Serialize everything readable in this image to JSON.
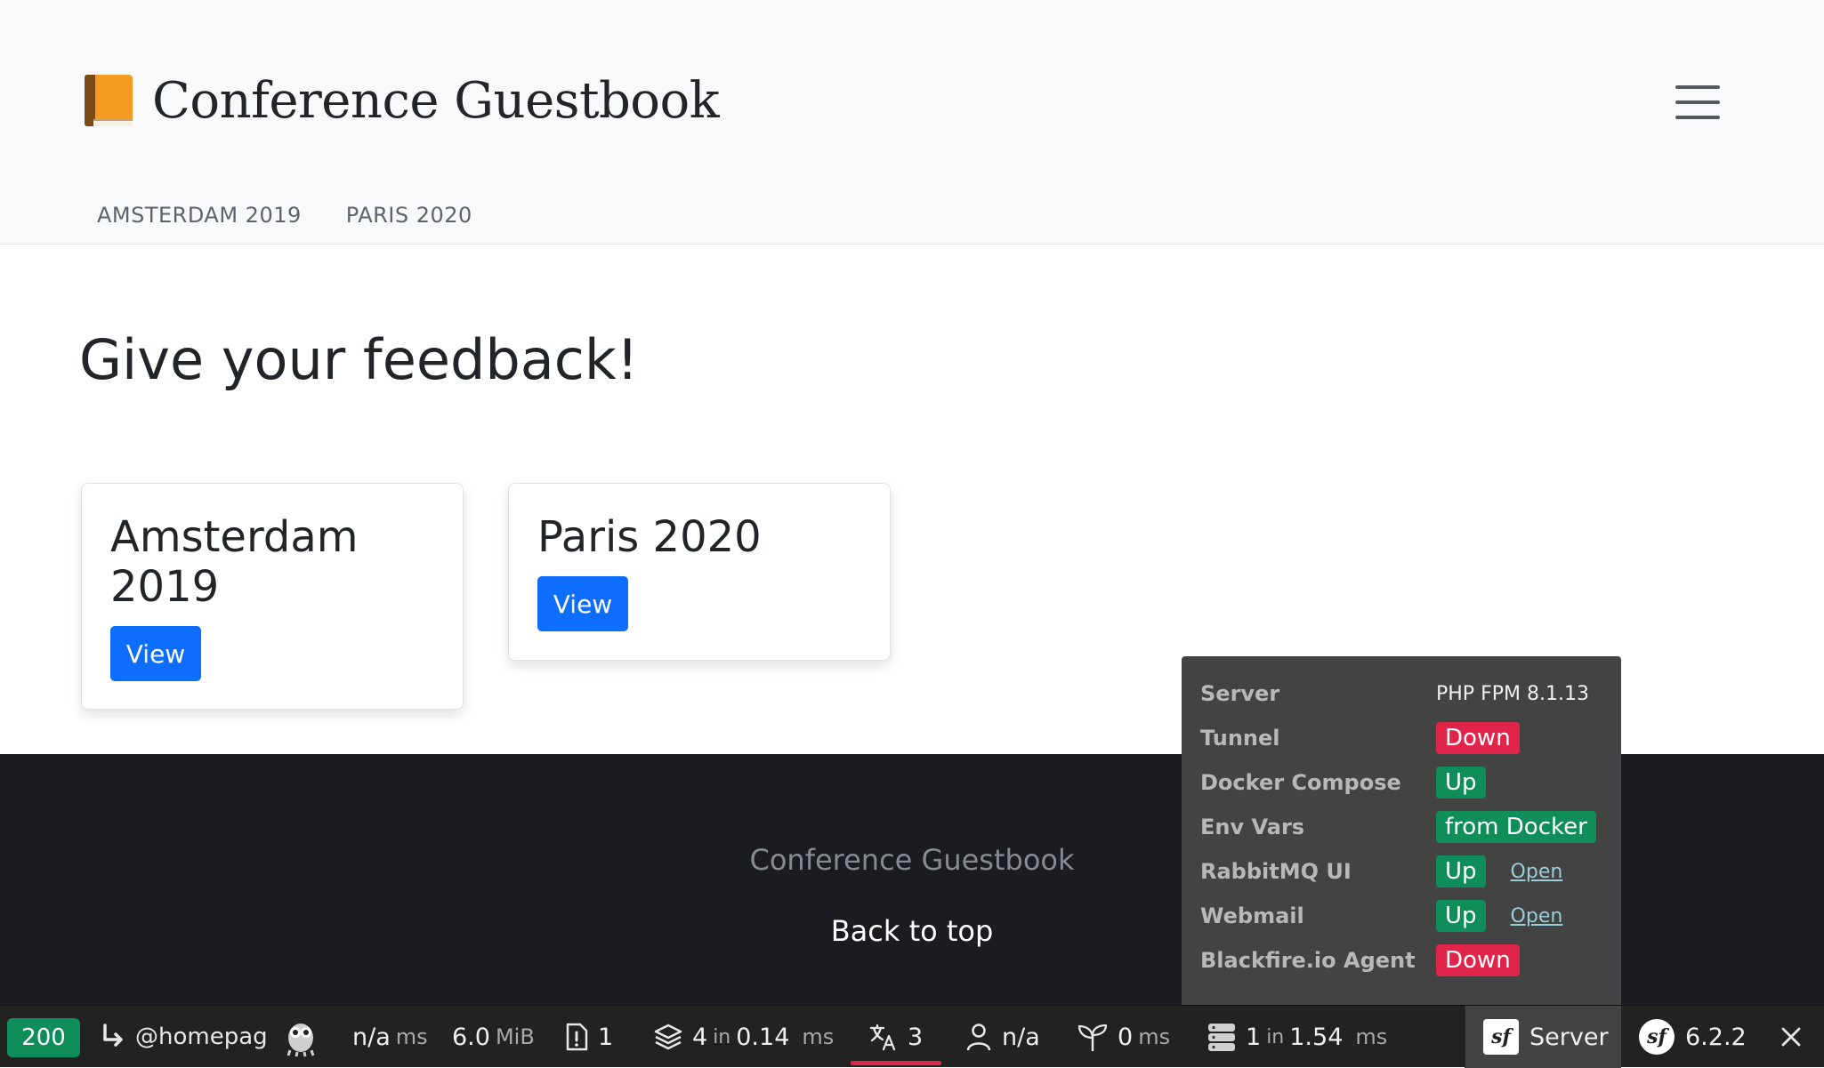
{
  "header": {
    "brand_title": "Conference Guestbook",
    "brand_icon": "orange-book-icon",
    "nav": [
      "AMSTERDAM 2019",
      "PARIS 2020"
    ]
  },
  "main": {
    "title": "Give your feedback!",
    "cards": [
      {
        "title": "Amsterdam 2019",
        "button": "View"
      },
      {
        "title": "Paris 2020",
        "button": "View"
      }
    ]
  },
  "footer": {
    "name": "Conference Guestbook",
    "back_to_top": "Back to top"
  },
  "server_panel": {
    "rows": [
      {
        "label": "Server",
        "value": "PHP FPM 8.1.13"
      },
      {
        "label": "Tunnel",
        "value": "Down"
      },
      {
        "label": "Docker Compose",
        "value": "Up"
      },
      {
        "label": "Env Vars",
        "value": "from Docker"
      },
      {
        "label": "RabbitMQ UI",
        "value": "Up",
        "link": "Open"
      },
      {
        "label": "Webmail",
        "value": "Up",
        "link": "Open"
      },
      {
        "label": "Blackfire.io Agent",
        "value": "Down"
      }
    ],
    "colors": {
      "up": "#0f8d5b",
      "down": "#e0244a"
    }
  },
  "toolbar": {
    "status": "200",
    "route": "@homepag",
    "time_value": "n/a",
    "time_unit": "ms",
    "memory_value": "6.0",
    "memory_unit": "MiB",
    "logs": "1",
    "cache_count": "4",
    "cache_in": "in",
    "cache_time": "0.14",
    "cache_unit": "ms",
    "translations": "3",
    "user": "n/a",
    "twig_value": "0",
    "twig_unit": "ms",
    "db_count": "1",
    "db_in": "in",
    "db_time": "1.54",
    "db_unit": "ms",
    "server_label": "Server",
    "symfony_version": "6.2.2"
  }
}
